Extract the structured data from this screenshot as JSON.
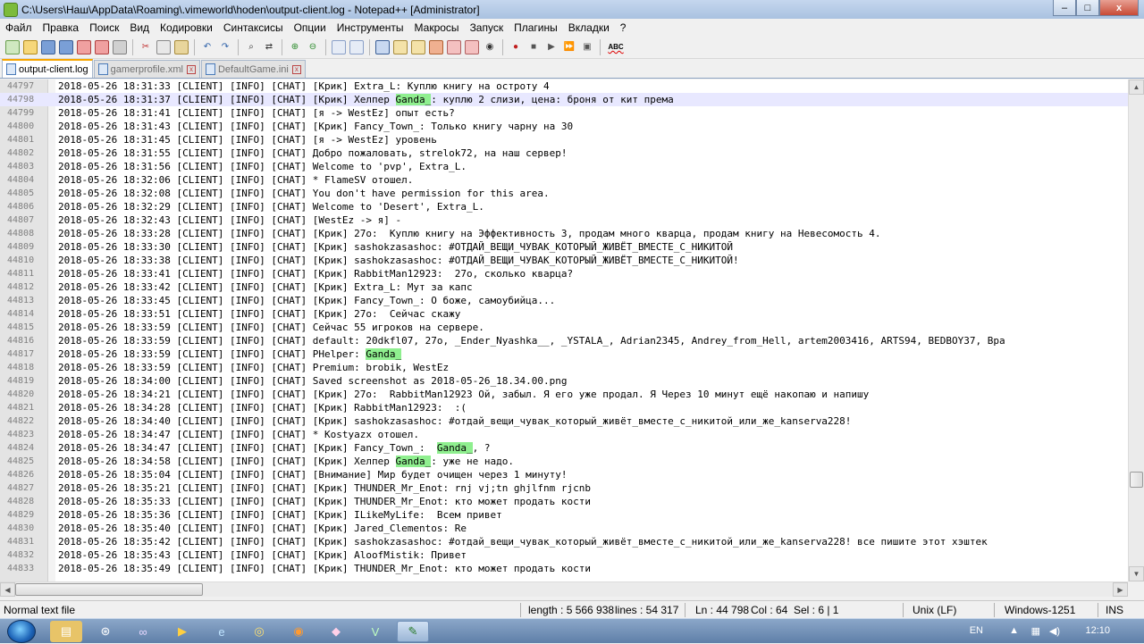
{
  "window": {
    "title": "C:\\Users\\Наш\\AppData\\Roaming\\.vimeworld\\hoden\\output-client.log - Notepad++ [Administrator]",
    "controls": [
      "–",
      "□",
      "x"
    ]
  },
  "menu": [
    "Файл",
    "Правка",
    "Поиск",
    "Вид",
    "Кодировки",
    "Синтаксисы",
    "Опции",
    "Инструменты",
    "Макросы",
    "Запуск",
    "Плагины",
    "Вкладки",
    "?"
  ],
  "toolbar": {
    "spellcheck_label": "ABC"
  },
  "tabs": [
    {
      "label": "output-client.log",
      "active": true
    },
    {
      "label": "gamerprofile.xml",
      "active": false
    },
    {
      "label": "DefaultGame.ini",
      "active": false
    }
  ],
  "editor": {
    "lines": [
      {
        "n": "44797",
        "pre": "2018-05-26 18:31:33 [CLIENT] [INFO] [CHAT] [Крик] Extra_L: Куплю книгу на остроту 4",
        "hl": "",
        "post": ""
      },
      {
        "n": "44798",
        "pre": "2018-05-26 18:31:37 [CLIENT] [INFO] [CHAT] [Крик] Хелпер ",
        "hl": "Ganda_",
        "post": ": куплю 2 слизи, цена: броня от кит према"
      },
      {
        "n": "44799",
        "pre": "2018-05-26 18:31:41 [CLIENT] [INFO] [CHAT] [я -> WestEz] опыт есть?",
        "hl": "",
        "post": ""
      },
      {
        "n": "44800",
        "pre": "2018-05-26 18:31:43 [CLIENT] [INFO] [CHAT] [Крик] Fancy_Town_: Только книгу чарну на 30",
        "hl": "",
        "post": ""
      },
      {
        "n": "44801",
        "pre": "2018-05-26 18:31:45 [CLIENT] [INFO] [CHAT] [я -> WestEz] уровень",
        "hl": "",
        "post": ""
      },
      {
        "n": "44802",
        "pre": "2018-05-26 18:31:55 [CLIENT] [INFO] [CHAT] Добро пожаловать, strelok72, на наш сервер!",
        "hl": "",
        "post": ""
      },
      {
        "n": "44803",
        "pre": "2018-05-26 18:31:56 [CLIENT] [INFO] [CHAT] Welcome to 'pvp', Extra_L.",
        "hl": "",
        "post": ""
      },
      {
        "n": "44804",
        "pre": "2018-05-26 18:32:06 [CLIENT] [INFO] [CHAT] * FlameSV отошел.",
        "hl": "",
        "post": ""
      },
      {
        "n": "44805",
        "pre": "2018-05-26 18:32:08 [CLIENT] [INFO] [CHAT] You don't have permission for this area.",
        "hl": "",
        "post": ""
      },
      {
        "n": "44806",
        "pre": "2018-05-26 18:32:29 [CLIENT] [INFO] [CHAT] Welcome to 'Desert', Extra_L.",
        "hl": "",
        "post": ""
      },
      {
        "n": "44807",
        "pre": "2018-05-26 18:32:43 [CLIENT] [INFO] [CHAT] [WestEz -> я] -",
        "hl": "",
        "post": ""
      },
      {
        "n": "44808",
        "pre": "2018-05-26 18:33:28 [CLIENT] [INFO] [CHAT] [Крик] 27o:  Куплю книгу на Эффективность 3, продам много кварца, продам книгу на Невесомость 4.",
        "hl": "",
        "post": ""
      },
      {
        "n": "44809",
        "pre": "2018-05-26 18:33:30 [CLIENT] [INFO] [CHAT] [Крик] sashokzasashoc: #ОТДАЙ_ВЕЩИ_ЧУВАК_КОТОРЫЙ_ЖИВЁТ_ВМЕСТЕ_С_НИКИТОЙ",
        "hl": "",
        "post": ""
      },
      {
        "n": "44810",
        "pre": "2018-05-26 18:33:38 [CLIENT] [INFO] [CHAT] [Крик] sashokzasashoc: #ОТДАЙ_ВЕЩИ_ЧУВАК_КОТОРЫЙ_ЖИВЁТ_ВМЕСТЕ_С_НИКИТОЙ!",
        "hl": "",
        "post": ""
      },
      {
        "n": "44811",
        "pre": "2018-05-26 18:33:41 [CLIENT] [INFO] [CHAT] [Крик] RabbitMan12923:  27o, сколько кварца?",
        "hl": "",
        "post": ""
      },
      {
        "n": "44812",
        "pre": "2018-05-26 18:33:42 [CLIENT] [INFO] [CHAT] [Крик] Extra_L: Мут за капс",
        "hl": "",
        "post": ""
      },
      {
        "n": "44813",
        "pre": "2018-05-26 18:33:45 [CLIENT] [INFO] [CHAT] [Крик] Fancy_Town_: О боже, самоубийца...",
        "hl": "",
        "post": ""
      },
      {
        "n": "44814",
        "pre": "2018-05-26 18:33:51 [CLIENT] [INFO] [CHAT] [Крик] 27o:  Сейчас скажу",
        "hl": "",
        "post": ""
      },
      {
        "n": "44815",
        "pre": "2018-05-26 18:33:59 [CLIENT] [INFO] [CHAT] Сейчас 55 игроков на сервере.",
        "hl": "",
        "post": ""
      },
      {
        "n": "44816",
        "pre": "2018-05-26 18:33:59 [CLIENT] [INFO] [CHAT] default: 20dkfl07, 27o, _Ender_Nyashka__, _YSTALA_, Adrian2345, Andrey_from_Hell, artem2003416, ARTS94, BEDBOY37, Bра",
        "hl": "",
        "post": ""
      },
      {
        "n": "44817",
        "pre": "2018-05-26 18:33:59 [CLIENT] [INFO] [CHAT] PHelper: ",
        "hl": "Ganda_",
        "post": ""
      },
      {
        "n": "44818",
        "pre": "2018-05-26 18:33:59 [CLIENT] [INFO] [CHAT] Premium: brobik, WestEz",
        "hl": "",
        "post": ""
      },
      {
        "n": "44819",
        "pre": "2018-05-26 18:34:00 [CLIENT] [INFO] [CHAT] Saved screenshot as 2018-05-26_18.34.00.png",
        "hl": "",
        "post": ""
      },
      {
        "n": "44820",
        "pre": "2018-05-26 18:34:21 [CLIENT] [INFO] [CHAT] [Крик] 27o:  RabbitMan12923 Ой, забыл. Я его уже продал. Я Через 10 минут ещё накопаю и напишу",
        "hl": "",
        "post": ""
      },
      {
        "n": "44821",
        "pre": "2018-05-26 18:34:28 [CLIENT] [INFO] [CHAT] [Крик] RabbitMan12923:  :(",
        "hl": "",
        "post": ""
      },
      {
        "n": "44822",
        "pre": "2018-05-26 18:34:40 [CLIENT] [INFO] [CHAT] [Крик] sashokzasashoc: #отдай_вещи_чувак_который_живёт_вместе_с_никитой_или_же_kanserva228!",
        "hl": "",
        "post": ""
      },
      {
        "n": "44823",
        "pre": "2018-05-26 18:34:47 [CLIENT] [INFO] [CHAT] * Kostyazx отошел.",
        "hl": "",
        "post": ""
      },
      {
        "n": "44824",
        "pre": "2018-05-26 18:34:47 [CLIENT] [INFO] [CHAT] [Крик] Fancy_Town_:  ",
        "hl": "Ganda_",
        "post": ", ?"
      },
      {
        "n": "44825",
        "pre": "2018-05-26 18:34:58 [CLIENT] [INFO] [CHAT] [Крик] Хелпер ",
        "hl": "Ganda_",
        "post": ": уже не надо."
      },
      {
        "n": "44826",
        "pre": "2018-05-26 18:35:04 [CLIENT] [INFO] [CHAT] [Внимание] Мир будет очищен через 1 минуту!",
        "hl": "",
        "post": ""
      },
      {
        "n": "44827",
        "pre": "2018-05-26 18:35:21 [CLIENT] [INFO] [CHAT] [Крик] THUNDER_Mr_Enot: rnj vj;tn ghjlfnm rjcnb",
        "hl": "",
        "post": ""
      },
      {
        "n": "44828",
        "pre": "2018-05-26 18:35:33 [CLIENT] [INFO] [CHAT] [Крик] THUNDER_Mr_Enot: кто может продать кости",
        "hl": "",
        "post": ""
      },
      {
        "n": "44829",
        "pre": "2018-05-26 18:35:36 [CLIENT] [INFO] [CHAT] [Крик] ILikeMyLife:  Всем привет",
        "hl": "",
        "post": ""
      },
      {
        "n": "44830",
        "pre": "2018-05-26 18:35:40 [CLIENT] [INFO] [CHAT] [Крик] Jared_Clementos: Re",
        "hl": "",
        "post": ""
      },
      {
        "n": "44831",
        "pre": "2018-05-26 18:35:42 [CLIENT] [INFO] [CHAT] [Крик] sashokzasashoc: #отдай_вещи_чувак_который_живёт_вместе_с_никитой_или_же_kanserva228! все пишите этот хэштек",
        "hl": "",
        "post": ""
      },
      {
        "n": "44832",
        "pre": "2018-05-26 18:35:43 [CLIENT] [INFO] [CHAT] [Крик] AloofMistik: Привет",
        "hl": "",
        "post": ""
      },
      {
        "n": "44833",
        "pre": "2018-05-26 18:35:49 [CLIENT] [INFO] [CHAT] [Крик] THUNDER_Mr_Enot: кто может продать кости",
        "hl": "",
        "post": ""
      }
    ]
  },
  "status": {
    "file_type": "Normal text file",
    "length": "length : 5 566 938",
    "lines": "lines : 54 317",
    "ln": "Ln : 44 798",
    "col": "Col : 64",
    "sel": "Sel : 6 | 1",
    "eol": "Unix (LF)",
    "encoding": "Windows-1251",
    "mode": "INS"
  },
  "taskbar": {
    "lang": "EN",
    "time": "12:10"
  }
}
